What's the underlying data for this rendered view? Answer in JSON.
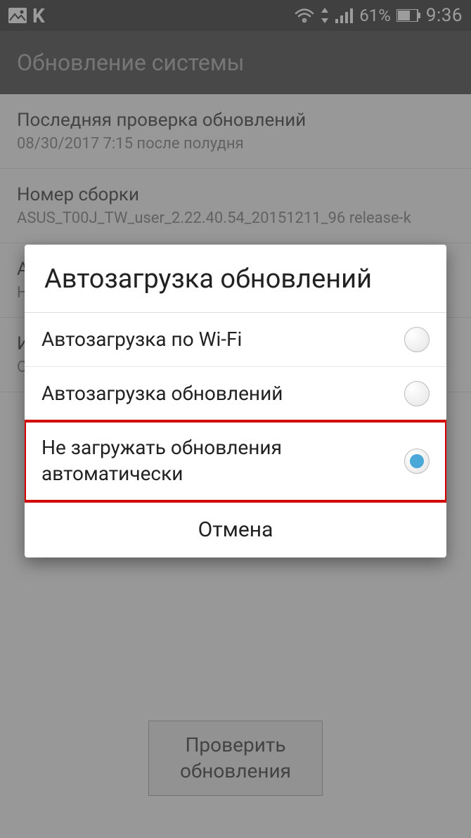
{
  "status": {
    "battery_percent": "61%",
    "clock": "9:36"
  },
  "header": {
    "title": "Обновление системы"
  },
  "items": [
    {
      "title": "Последняя проверка обновлений",
      "subtitle": "08/30/2017 7:15 после полудня"
    },
    {
      "title": "Номер сборки",
      "subtitle": "ASUS_T00J_TW_user_2.22.40.54_20151211_96 release-k"
    },
    {
      "title": "А",
      "subtitle": "Н"
    },
    {
      "title": "И",
      "subtitle": "О"
    }
  ],
  "check_button": "Проверить\nобновления",
  "dialog": {
    "title": "Автозагрузка обновлений",
    "options": [
      {
        "label": "Автозагрузка по Wi-Fi",
        "selected": false,
        "highlighted": false
      },
      {
        "label": "Автозагрузка обновлений",
        "selected": false,
        "highlighted": false
      },
      {
        "label": "Не загружать обновления автоматически",
        "selected": true,
        "highlighted": true
      }
    ],
    "cancel": "Отмена"
  }
}
